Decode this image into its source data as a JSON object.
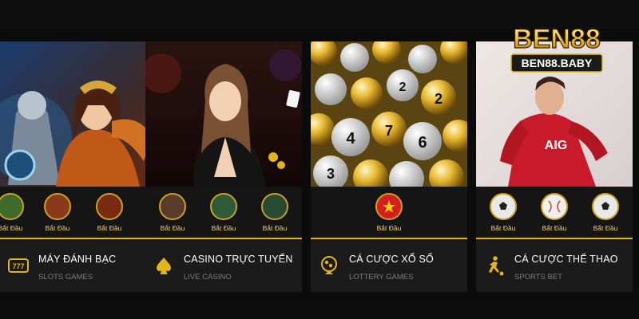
{
  "colors": {
    "accent": "#e2b51a",
    "card_bg": "#1b1b1b",
    "page_bg": "#0b0b0b"
  },
  "logo": {
    "main": "BEN88",
    "domain": "BEN88.BABY"
  },
  "cards": [
    {
      "title": "MÁY ĐÁNH BẠC",
      "subtitle": "SLOTS GAMES",
      "icon": "slot-machine-777-icon",
      "games": [
        {
          "label": "Bắt Đầu"
        },
        {
          "label": "Bắt Đầu"
        },
        {
          "label": "Bắt Đầu"
        }
      ]
    },
    {
      "title": "CASINO TRỰC TUYẾN",
      "subtitle": "LIVE CASINO",
      "icon": "spade-chip-icon",
      "games": [
        {
          "label": "Bắt Đầu"
        },
        {
          "label": "Bắt Đầu"
        },
        {
          "label": "Bắt Đầu"
        }
      ]
    },
    {
      "title": "CÁ CƯỢC XỔ SỐ",
      "subtitle": "LOTTERY GAMES",
      "icon": "lottery-globe-icon",
      "games": [
        {
          "label": "Bắt Đầu"
        }
      ]
    },
    {
      "title": "CÁ CƯỢC THỂ THAO",
      "subtitle": "SPORTS BET",
      "icon": "soccer-player-icon",
      "games": [
        {
          "label": "Bắt Đầu"
        },
        {
          "label": "Bắt Đầu"
        },
        {
          "label": "Bắt Đầu"
        }
      ]
    }
  ],
  "hero_texts": {
    "ball_numbers": [
      "2",
      "2",
      "4",
      "6",
      "7",
      "3"
    ],
    "jersey_text": "AIG"
  }
}
